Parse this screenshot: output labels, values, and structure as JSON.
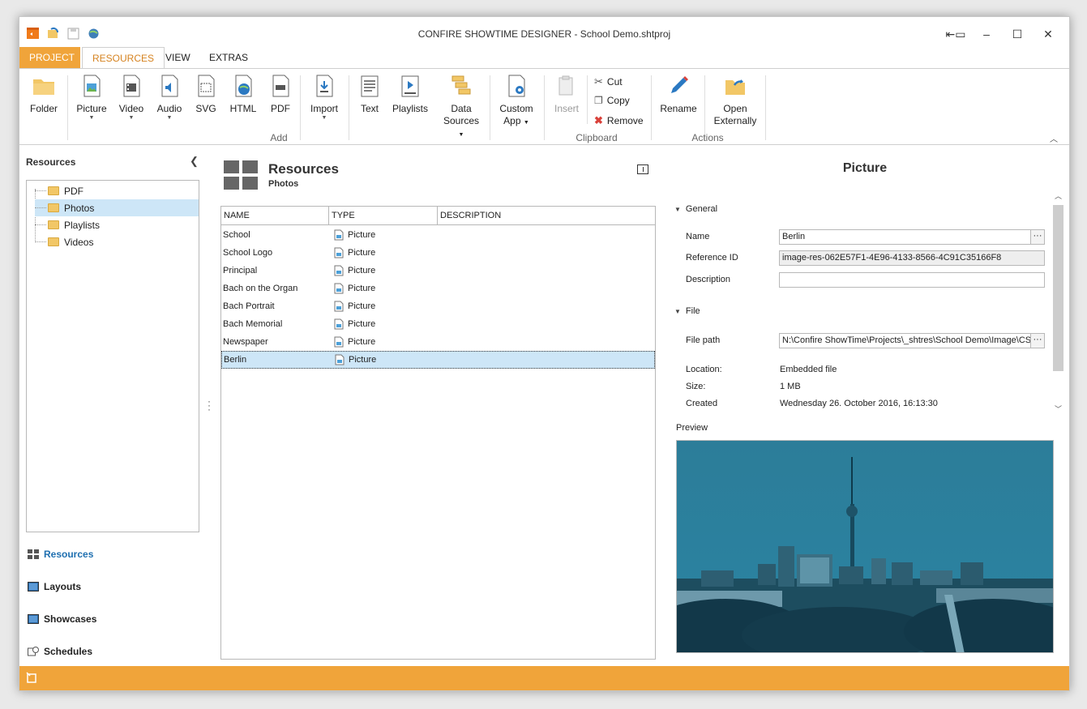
{
  "window": {
    "title": "CONFIRE SHOWTIME DESIGNER - School Demo.shtproj"
  },
  "ribbon": {
    "tabs": [
      "PROJECT",
      "RESOURCES",
      "VIEW",
      "EXTRAS"
    ],
    "add_buttons": [
      {
        "label": "Folder"
      },
      {
        "label": "Picture"
      },
      {
        "label": "Video"
      },
      {
        "label": "Audio"
      },
      {
        "label": "SVG"
      },
      {
        "label": "HTML"
      },
      {
        "label": "PDF"
      },
      {
        "label": "Import"
      },
      {
        "label": "Text"
      },
      {
        "label": "Playlists"
      },
      {
        "label": "Data",
        "label2": "Sources"
      },
      {
        "label": "Custom",
        "label2": "App"
      }
    ],
    "add_group": "Add",
    "clipboard": {
      "insert": "Insert",
      "cut": "Cut",
      "copy": "Copy",
      "remove": "Remove",
      "group": "Clipboard"
    },
    "actions": {
      "rename": "Rename",
      "open1": "Open",
      "open2": "Externally",
      "group": "Actions"
    }
  },
  "left": {
    "title": "Resources",
    "tree": [
      "PDF",
      "Photos",
      "Playlists",
      "Videos"
    ],
    "selected_tree_index": 1,
    "nav": [
      "Resources",
      "Layouts",
      "Showcases",
      "Schedules"
    ]
  },
  "center": {
    "title": "Resources",
    "subtitle": "Photos",
    "columns": [
      "NAME",
      "TYPE",
      "DESCRIPTION"
    ],
    "rows": [
      {
        "name": "School",
        "type": "Picture"
      },
      {
        "name": "School Logo",
        "type": "Picture"
      },
      {
        "name": "Principal",
        "type": "Picture"
      },
      {
        "name": "Bach on the Organ",
        "type": "Picture"
      },
      {
        "name": "Bach Portrait",
        "type": "Picture"
      },
      {
        "name": "Bach Memorial",
        "type": "Picture"
      },
      {
        "name": "Newspaper",
        "type": "Picture"
      },
      {
        "name": "Berlin",
        "type": "Picture"
      }
    ],
    "selected_row_index": 7
  },
  "right": {
    "title": "Picture",
    "general": "General",
    "name_label": "Name",
    "name_value": "Berlin",
    "refid_label": "Reference ID",
    "refid_value": "image-res-062E57F1-4E96-4133-8566-4C91C35166F8",
    "desc_label": "Description",
    "desc_value": "",
    "file": "File",
    "filepath_label": "File path",
    "filepath_value": "N:\\Confire ShowTime\\Projects\\_shtres\\School Demo\\Image\\CST",
    "location_label": "Location:",
    "location_value": "Embedded file",
    "size_label": "Size:",
    "size_value": "1 MB",
    "created_label": "Created",
    "created_value": "Wednesday 26. October 2016, 16:13:30",
    "preview_label": "Preview",
    "ellipsis": "···"
  },
  "colors": {
    "accent": "#f0a43a",
    "tab_active_text": "#d68320",
    "selection": "#cde6f7",
    "nav_active": "#1e6fb0",
    "preview_tint": "#2a7a96"
  }
}
